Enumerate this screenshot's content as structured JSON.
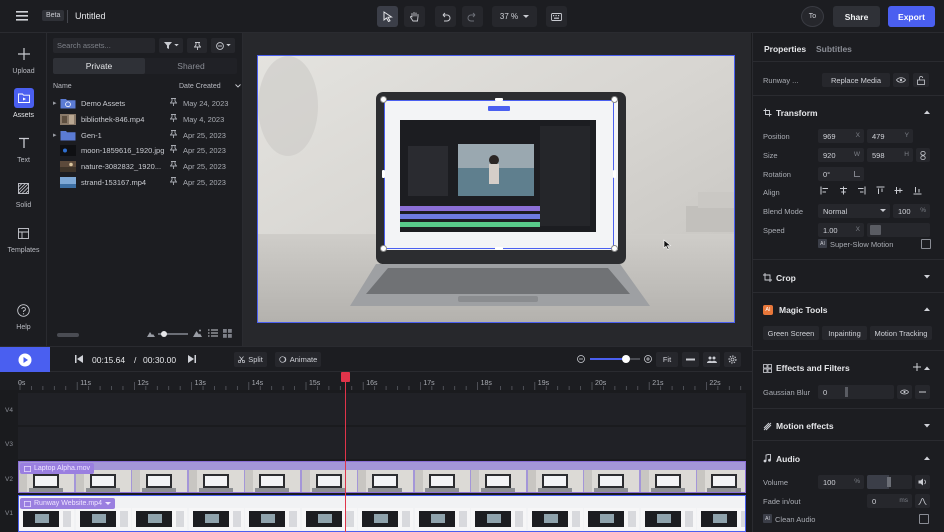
{
  "header": {
    "badge": "Beta",
    "title": "Untitled",
    "zoom": "37 %",
    "avatar_initials": "To",
    "share_label": "Share",
    "export_label": "Export"
  },
  "rail": {
    "items": [
      {
        "label": "Upload",
        "icon": "plus-icon"
      },
      {
        "label": "Assets",
        "icon": "folder-play-icon"
      },
      {
        "label": "Text",
        "icon": "text-icon"
      },
      {
        "label": "Solid",
        "icon": "solid-icon"
      },
      {
        "label": "Templates",
        "icon": "templates-icon"
      },
      {
        "label": "Help",
        "icon": "help-icon"
      }
    ]
  },
  "assets": {
    "search_placeholder": "Search assets...",
    "tabs": [
      "Private",
      "Shared"
    ],
    "col_name": "Name",
    "col_date": "Date Created",
    "rows": [
      {
        "name": "Demo Assets",
        "date": "May 24, 2023",
        "kind": "folder-special",
        "expandable": true
      },
      {
        "name": "bibliothek-846.mp4",
        "date": "May 4, 2023",
        "kind": "video",
        "expandable": false
      },
      {
        "name": "Gen-1",
        "date": "Apr 25, 2023",
        "kind": "folder",
        "expandable": true
      },
      {
        "name": "moon-1859616_1920.jpg",
        "date": "Apr 25, 2023",
        "kind": "image-dark",
        "expandable": false
      },
      {
        "name": "nature-3082832_1920...",
        "date": "Apr 25, 2023",
        "kind": "image",
        "expandable": false
      },
      {
        "name": "strand-153167.mp4",
        "date": "Apr 25, 2023",
        "kind": "video-sky",
        "expandable": false
      }
    ]
  },
  "transport": {
    "current": "00:15.64",
    "separator": "/",
    "total": "00:30.00",
    "split_label": "Split",
    "animate_label": "Animate",
    "fit_label": "Fit"
  },
  "ruler": {
    "labels": [
      "0s",
      "11s",
      "12s",
      "13s",
      "14s",
      "15s",
      "16s",
      "17s",
      "18s",
      "19s",
      "20s",
      "21s",
      "22s"
    ]
  },
  "tracks": {
    "labels": [
      "V4",
      "V3",
      "V2",
      "V1"
    ],
    "clip_v2": "Laptop Alpha.mov",
    "clip_v1": "Runway Website.mp4"
  },
  "props": {
    "tabs": [
      "Properties",
      "Subtitles"
    ],
    "layer_name": "Runway ...",
    "replace_label": "Replace Media",
    "transform_title": "Transform",
    "position_label": "Position",
    "pos_x": "969",
    "pos_x_unit": "X",
    "pos_y": "479",
    "pos_y_unit": "Y",
    "size_label": "Size",
    "size_w": "920",
    "size_w_unit": "W",
    "size_h": "598",
    "size_h_unit": "H",
    "rotation_label": "Rotation",
    "rotation": "0°",
    "align_label": "Align",
    "blend_label": "Blend Mode",
    "blend_value": "Normal",
    "opacity": "100",
    "opacity_unit": "%",
    "speed_label": "Speed",
    "speed": "1.00",
    "speed_unit": "X",
    "slow_motion_label": "Super-Slow Motion",
    "crop_title": "Crop",
    "magic_title": "Magic Tools",
    "magic_badge": "AI",
    "magic_buttons": [
      "Green Screen",
      "Inpainting",
      "Motion Tracking"
    ],
    "effects_title": "Effects and Filters",
    "blur_label": "Gaussian Blur",
    "blur_value": "0",
    "motion_title": "Motion effects",
    "audio_title": "Audio",
    "volume_label": "Volume",
    "volume": "100",
    "volume_unit": "%",
    "fade_label": "Fade in/out",
    "fade_value": "0",
    "fade_unit": "ms",
    "clean_audio_label": "Clean Audio"
  },
  "colors": {
    "accent": "#4a5ff0",
    "playhead": "#e0344a",
    "clip": "#8b6fd6"
  }
}
